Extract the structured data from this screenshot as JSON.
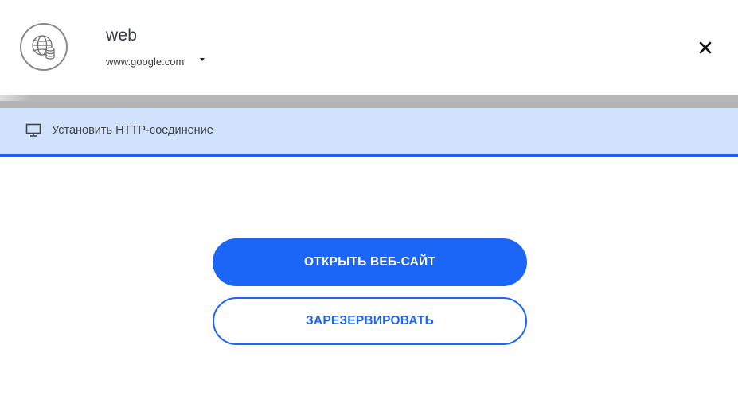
{
  "header": {
    "title": "web",
    "url": "www.google.com",
    "avatar_icon": "globe-database-icon",
    "dropdown_icon": "caret-down-icon",
    "close_icon": "close-icon"
  },
  "info_bar": {
    "icon": "monitor-icon",
    "text": "Установить HTTP-соединение"
  },
  "actions": {
    "open_label": "ОТКРЫТЬ ВЕБ-САЙТ",
    "reserve_label": "ЗАРЕЗЕРВИРОВАТЬ"
  },
  "colors": {
    "accent": "#1b66f7",
    "info_bg": "#d3e2fc",
    "divider": "#b5b5b5"
  }
}
